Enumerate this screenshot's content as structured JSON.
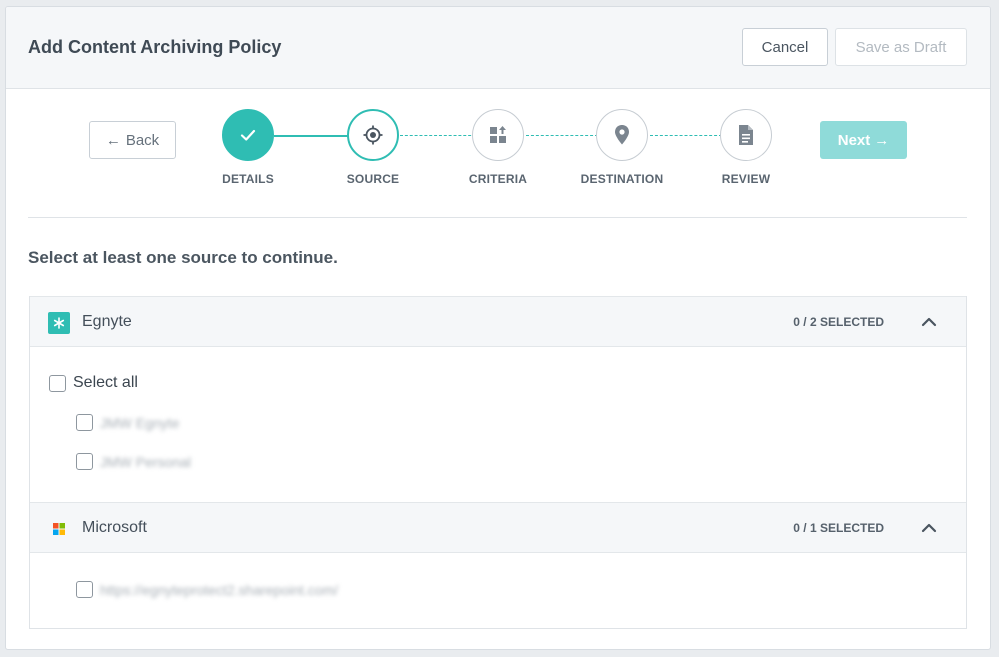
{
  "header": {
    "title": "Add Content Archiving Policy",
    "cancel_label": "Cancel",
    "draft_label": "Save as Draft"
  },
  "nav": {
    "back_label": "Back",
    "next_label": "Next"
  },
  "steps": [
    {
      "label": "DETAILS",
      "state": "done",
      "icon": "check-icon"
    },
    {
      "label": "SOURCE",
      "state": "active",
      "icon": "target-icon"
    },
    {
      "label": "CRITERIA",
      "state": "pending",
      "icon": "criteria-icon"
    },
    {
      "label": "DESTINATION",
      "state": "pending",
      "icon": "map-pin-icon"
    },
    {
      "label": "REVIEW",
      "state": "pending",
      "icon": "document-icon"
    }
  ],
  "instructions": "Select at least one source to continue.",
  "sources": [
    {
      "name": "Egnyte",
      "count": "0 / 2 SELECTED",
      "select_all_label": "Select all",
      "items": [
        "JMW Egnyte",
        "JMW Personal"
      ]
    },
    {
      "name": "Microsoft",
      "count": "0 / 1 SELECTED",
      "items": [
        "https://egnyteprotect2.sharepoint.com/"
      ]
    }
  ],
  "colors": {
    "accent": "#2fbdb3",
    "next_disabled": "#8fdbd9",
    "ms_red": "#f35325",
    "ms_green": "#81bc06",
    "ms_blue": "#05a6f0",
    "ms_yellow": "#ffba08"
  }
}
